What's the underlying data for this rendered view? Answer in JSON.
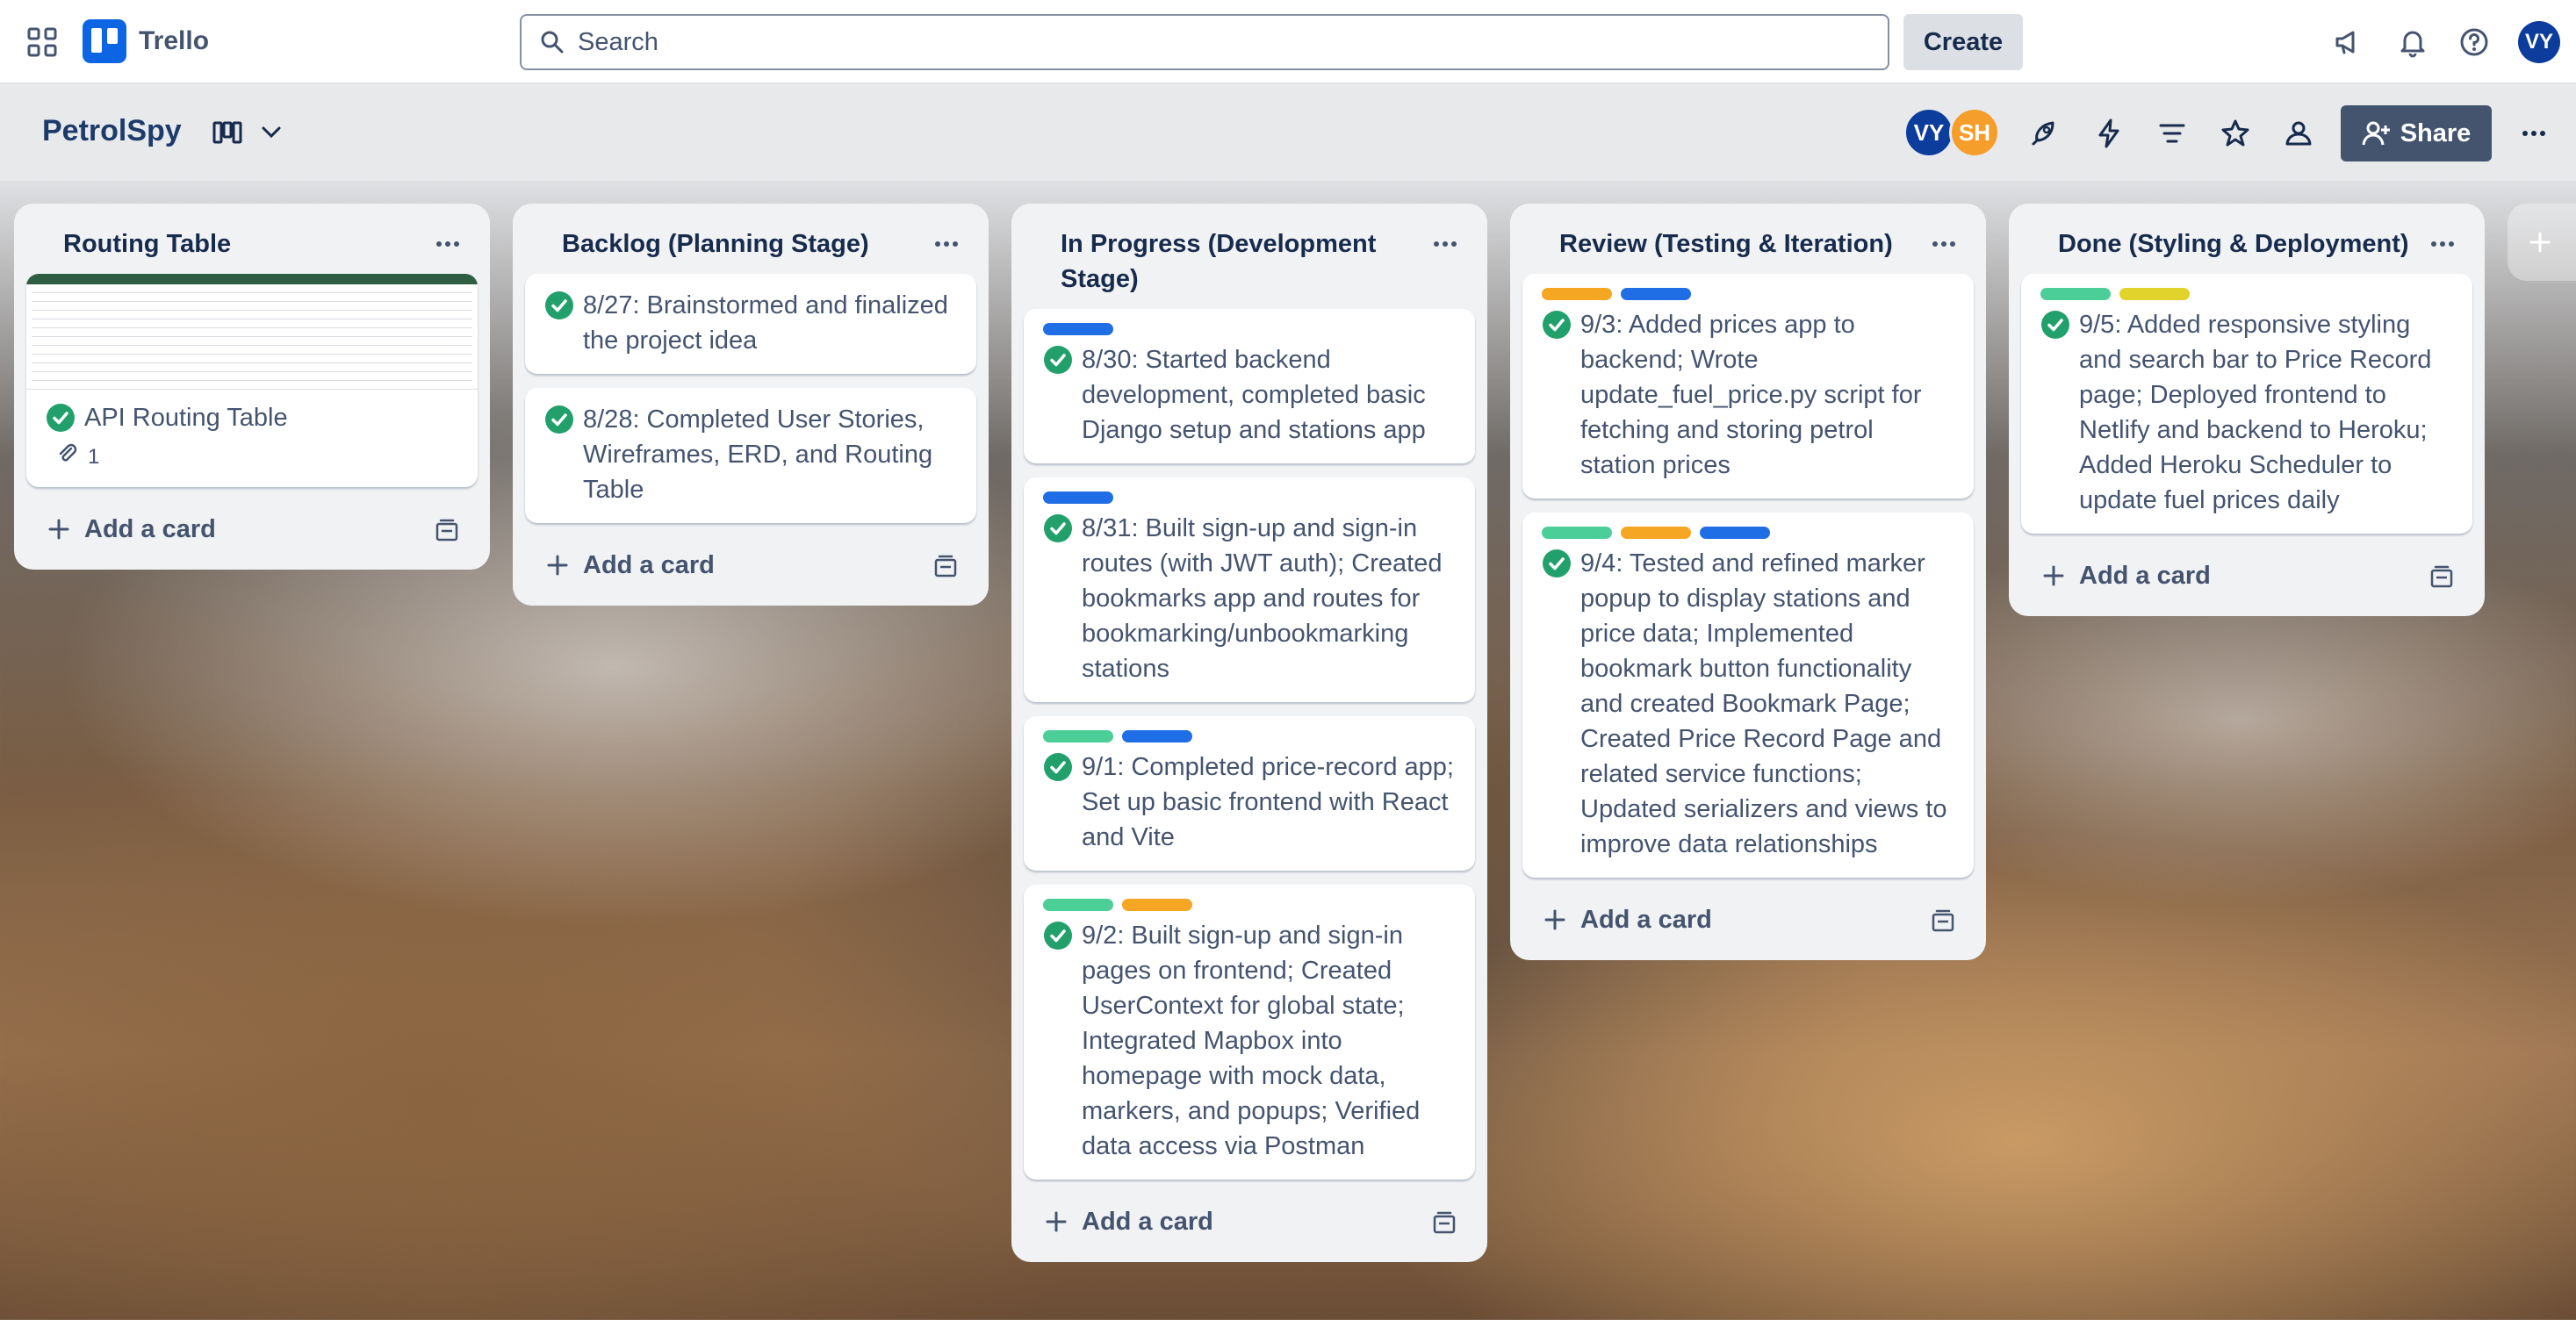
{
  "app": {
    "name": "Trello"
  },
  "search": {
    "placeholder": "Search"
  },
  "header": {
    "create_label": "Create",
    "user_initials": "VY"
  },
  "board": {
    "title": "PetrolSpy",
    "members": [
      {
        "initials": "VY",
        "color": "#0c3c9c"
      },
      {
        "initials": "SH",
        "color": "#f59e2b"
      }
    ],
    "share_label": "Share"
  },
  "colors": {
    "green": "#4bce97",
    "orange": "#f5a623",
    "blue": "#1f6ee6",
    "yellow": "#e2d32c",
    "check": "#22a06b"
  },
  "lists": [
    {
      "title": "Routing Table",
      "cards": [
        {
          "text": "API Routing Table",
          "attachments": "1",
          "labels": []
        }
      ],
      "add_label": "Add a card"
    },
    {
      "title": "Backlog (Planning Stage)",
      "cards": [
        {
          "text": "8/27: Brainstormed and finalized the project idea",
          "labels": []
        },
        {
          "text": "8/28: Completed User Stories, Wireframes, ERD, and Routing Table",
          "labels": []
        }
      ],
      "add_label": "Add a card"
    },
    {
      "title": "In Progress (Development Stage)",
      "cards": [
        {
          "text": "8/30: Started backend development, completed basic Django setup and stations app",
          "labels": [
            "blue"
          ]
        },
        {
          "text": "8/31: Built sign-up and sign-in routes (with JWT auth); Created bookmarks app and routes for bookmarking/unbookmarking stations",
          "labels": [
            "blue"
          ]
        },
        {
          "text": "9/1: Completed price-record app; Set up basic frontend with React and Vite",
          "labels": [
            "green",
            "blue"
          ]
        },
        {
          "text": "9/2: Built sign-up and sign-in pages on frontend; Created UserContext for global state; Integrated Mapbox into homepage with mock data, markers, and popups; Verified data access via Postman",
          "labels": [
            "green",
            "orange"
          ]
        }
      ],
      "add_label": "Add a card"
    },
    {
      "title": "Review (Testing & Iteration)",
      "cards": [
        {
          "text": "9/3: Added prices app to backend; Wrote update_fuel_price.py script for fetching and storing petrol station prices",
          "labels": [
            "orange",
            "blue"
          ]
        },
        {
          "text": "9/4: Tested and refined marker popup to display stations and price data; Implemented bookmark button functionality and created Bookmark Page; Created Price Record Page and related service functions; Updated serializers and views to improve data relationships",
          "labels": [
            "green",
            "orange",
            "blue"
          ]
        }
      ],
      "add_label": "Add a card"
    },
    {
      "title": "Done (Styling & Deployment)",
      "cards": [
        {
          "text": "9/5: Added responsive styling and search bar to Price Record page; Deployed frontend to Netlify and backend to Heroku; Added Heroku Scheduler to update fuel prices daily",
          "labels": [
            "green",
            "yellow"
          ]
        }
      ],
      "add_label": "Add a card"
    }
  ]
}
